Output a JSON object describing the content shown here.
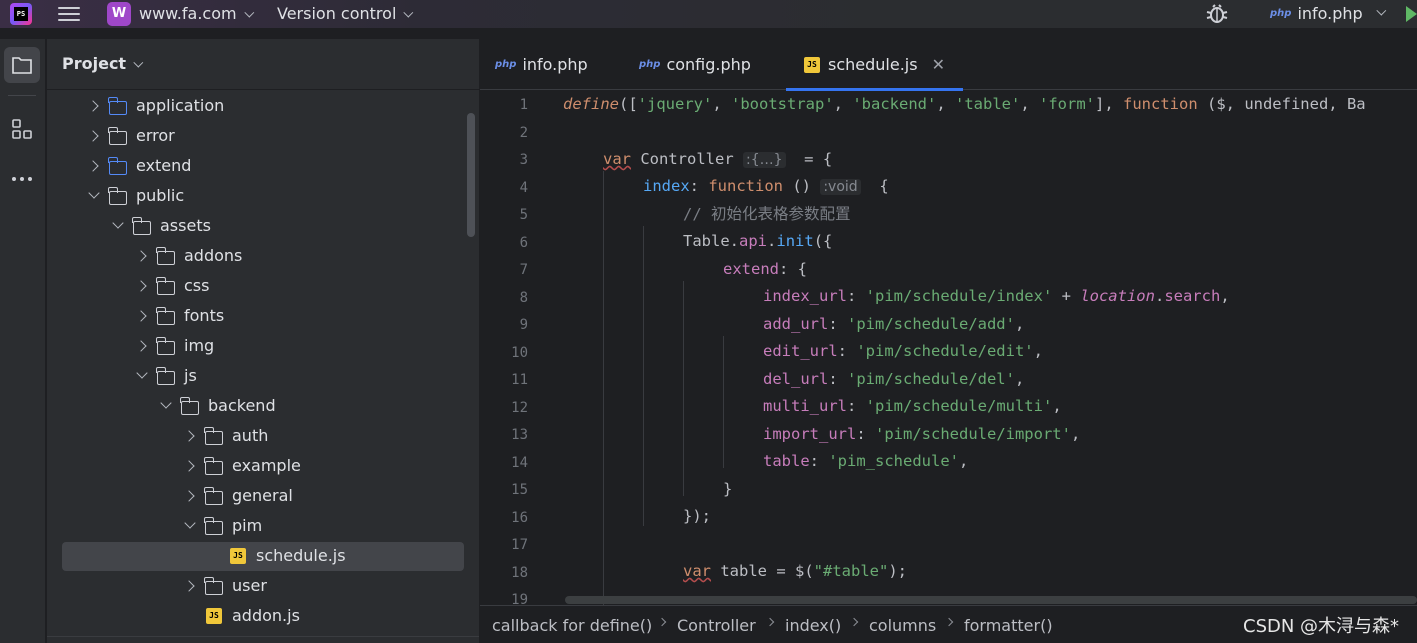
{
  "titlebar": {
    "logo_text": "PS",
    "menu_icon": "hamburger-icon",
    "project_badge": "W",
    "project_name": "www.fa.com",
    "vcs_label": "Version control",
    "run_config": "info.php",
    "run_config_icon_text": "php",
    "icons": [
      "debug-bug-icon",
      "run-icon"
    ]
  },
  "toolstrip": {
    "items": [
      "project-folder-icon",
      "structure-icon",
      "more-icon"
    ]
  },
  "project_panel": {
    "title": "Project",
    "tree": [
      {
        "label": "application",
        "kind": "folder-blue",
        "level": 0,
        "state": "collapsed"
      },
      {
        "label": "error",
        "kind": "folder",
        "level": 0,
        "state": "collapsed"
      },
      {
        "label": "extend",
        "kind": "folder-blue",
        "level": 0,
        "state": "collapsed"
      },
      {
        "label": "public",
        "kind": "folder",
        "level": 0,
        "state": "expanded"
      },
      {
        "label": "assets",
        "kind": "folder",
        "level": 1,
        "state": "expanded"
      },
      {
        "label": "addons",
        "kind": "folder",
        "level": 2,
        "state": "collapsed"
      },
      {
        "label": "css",
        "kind": "folder",
        "level": 2,
        "state": "collapsed"
      },
      {
        "label": "fonts",
        "kind": "folder",
        "level": 2,
        "state": "collapsed"
      },
      {
        "label": "img",
        "kind": "folder",
        "level": 2,
        "state": "collapsed"
      },
      {
        "label": "js",
        "kind": "folder",
        "level": 2,
        "state": "expanded"
      },
      {
        "label": "backend",
        "kind": "folder",
        "level": 3,
        "state": "expanded"
      },
      {
        "label": "auth",
        "kind": "folder",
        "level": 4,
        "state": "collapsed"
      },
      {
        "label": "example",
        "kind": "folder",
        "level": 4,
        "state": "collapsed"
      },
      {
        "label": "general",
        "kind": "folder",
        "level": 4,
        "state": "collapsed"
      },
      {
        "label": "pim",
        "kind": "folder",
        "level": 4,
        "state": "expanded"
      },
      {
        "label": "schedule.js",
        "kind": "js",
        "level": 5,
        "state": "leaf",
        "selected": true
      },
      {
        "label": "user",
        "kind": "folder",
        "level": 4,
        "state": "collapsed"
      },
      {
        "label": "addon.js",
        "kind": "js",
        "level": 4,
        "state": "leaf"
      }
    ]
  },
  "editor": {
    "tabs": [
      {
        "label": "info.php",
        "icon": "php",
        "active": false
      },
      {
        "label": "config.php",
        "icon": "php",
        "active": false
      },
      {
        "label": "schedule.js",
        "icon": "JS",
        "active": true,
        "closable": true
      }
    ],
    "line_numbers": [
      "1",
      "2",
      "3",
      "4",
      "5",
      "6",
      "7",
      "8",
      "9",
      "10",
      "11",
      "12",
      "13",
      "14",
      "15",
      "16",
      "17",
      "18",
      "19"
    ],
    "code": {
      "l1": {
        "a": "define",
        "b": "([",
        "c": "'jquery'",
        "d": ", ",
        "e": "'bootstrap'",
        "f": ", ",
        "g": "'backend'",
        "h": ", ",
        "i": "'table'",
        "j": ", ",
        "k": "'form'",
        "l": "], ",
        "m": "function",
        "n": " ($, undefined, Ba"
      },
      "l3": {
        "a": "var",
        "b": " Controller ",
        "hint": ":{…}",
        "c": "  = {"
      },
      "l4": {
        "a": "index",
        "b": ": ",
        "c": "function",
        "d": " () ",
        "hint": ":void",
        "e": "  {"
      },
      "l5": {
        "a": "// 初始化表格参数配置"
      },
      "l6": {
        "a": "Table",
        "b": ".",
        "c": "api",
        "d": ".",
        "e": "init",
        "f": "({"
      },
      "l7": {
        "a": "extend",
        "b": ": {"
      },
      "l8": {
        "a": "index_url",
        "b": ": ",
        "c": "'pim/schedule/index'",
        "d": " + ",
        "e": "location",
        "f": ".",
        "g": "search",
        "h": ","
      },
      "l9": {
        "a": "add_url",
        "b": ": ",
        "c": "'pim/schedule/add'",
        "d": ","
      },
      "l10": {
        "a": "edit_url",
        "b": ": ",
        "c": "'pim/schedule/edit'",
        "d": ","
      },
      "l11": {
        "a": "del_url",
        "b": ": ",
        "c": "'pim/schedule/del'",
        "d": ","
      },
      "l12": {
        "a": "multi_url",
        "b": ": ",
        "c": "'pim/schedule/multi'",
        "d": ","
      },
      "l13": {
        "a": "import_url",
        "b": ": ",
        "c": "'pim/schedule/import'",
        "d": ","
      },
      "l14": {
        "a": "table",
        "b": ": ",
        "c": "'pim_schedule'",
        "d": ","
      },
      "l15": {
        "a": "}"
      },
      "l16": {
        "a": "});"
      },
      "l18": {
        "a": "var",
        "b": " table = $(",
        "c": "\"#table\"",
        "d": ");"
      }
    },
    "breadcrumbs": [
      "callback for define()",
      "Controller",
      "index()",
      "columns",
      "formatter()"
    ]
  },
  "watermark": "CSDN @木浔与森*",
  "colors": {
    "background": "#1e1f22",
    "panel": "#2b2d30",
    "accent": "#3574f0",
    "keyword": "#cf8e6d",
    "string": "#6aab73",
    "property": "#c77dbb",
    "function": "#56a8f5"
  }
}
